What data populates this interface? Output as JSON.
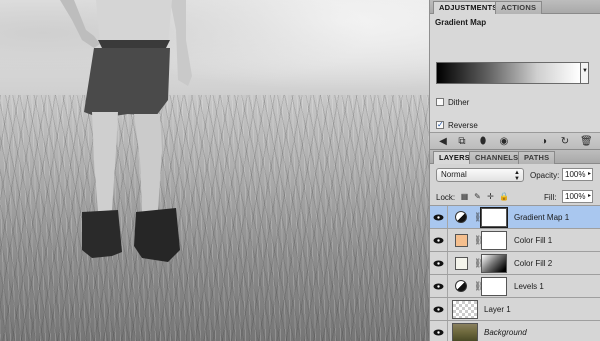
{
  "canvas": {
    "description_icon": "photo-canvas"
  },
  "adjustments_panel": {
    "tabs": [
      {
        "label": "ADJUSTMENTS",
        "active": true
      },
      {
        "label": "ACTIONS",
        "active": false
      }
    ],
    "title": "Gradient Map",
    "gradient": {
      "from": "#000000",
      "to": "#ffffff"
    },
    "dither_label": "Dither",
    "dither_checked": false,
    "reverse_label": "Reverse",
    "reverse_checked": true,
    "toolbar_icons": [
      "back-arrow-icon",
      "expand-view-icon",
      "clip-to-layer-icon",
      "visibility-eye-icon",
      "view-previous-icon",
      "reset-icon",
      "delete-icon"
    ]
  },
  "layers_panel": {
    "tabs": [
      {
        "label": "LAYERS",
        "active": true
      },
      {
        "label": "CHANNELS",
        "active": false
      },
      {
        "label": "PATHS",
        "active": false
      }
    ],
    "blend_mode": "Normal",
    "opacity_label": "Opacity:",
    "opacity_value": "100%",
    "lock_label": "Lock:",
    "fill_label": "Fill:",
    "fill_value": "100%",
    "layers": [
      {
        "name": "Gradient Map 1",
        "kind": "adjustment",
        "icon": "gradient-map-icon",
        "mask": "white",
        "selected": true,
        "italic": false
      },
      {
        "name": "Color Fill 1",
        "kind": "fill",
        "swatch": "#f5bf8e",
        "mask": "white",
        "selected": false,
        "italic": false
      },
      {
        "name": "Color Fill 2",
        "kind": "fill",
        "swatch": "#f4f4ec",
        "mask": "gradient",
        "selected": false,
        "italic": false
      },
      {
        "name": "Levels 1",
        "kind": "adjustment",
        "icon": "levels-icon",
        "mask": "white",
        "selected": false,
        "italic": false
      },
      {
        "name": "Layer 1",
        "kind": "pixel",
        "thumb": "transparent",
        "selected": false,
        "italic": false
      },
      {
        "name": "Background",
        "kind": "pixel",
        "thumb": "photo",
        "selected": false,
        "italic": true
      }
    ]
  }
}
